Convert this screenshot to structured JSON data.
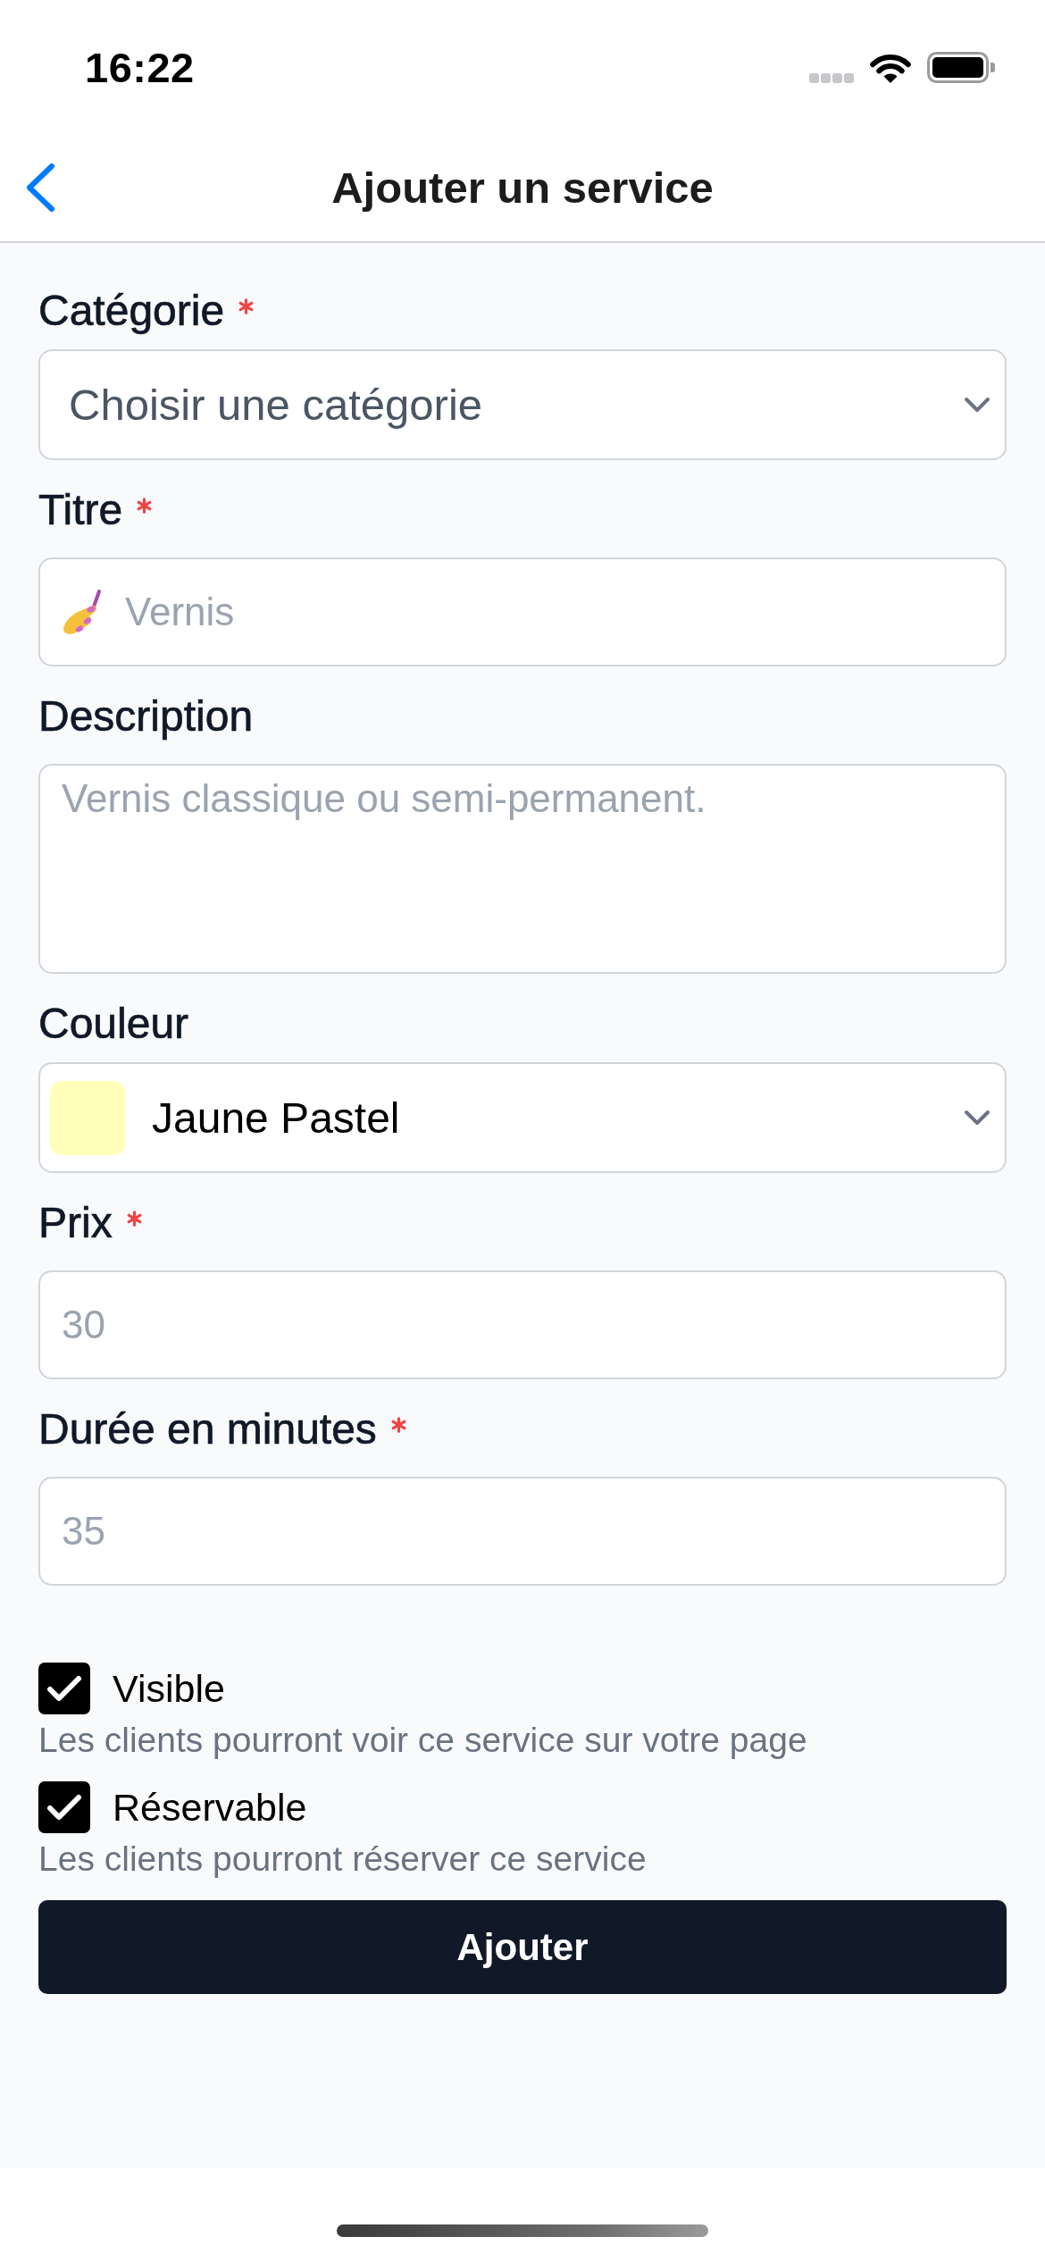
{
  "status_bar": {
    "time": "16:22"
  },
  "nav_bar": {
    "title": "Ajouter un service"
  },
  "form": {
    "fields": [
      {
        "kind": "select",
        "label": "Catégorie",
        "required": true,
        "placeholder": "Choisir une catégorie"
      },
      {
        "kind": "icon_input",
        "label": "Titre",
        "required": true,
        "placeholder": "Vernis"
      },
      {
        "kind": "textarea",
        "label": "Description",
        "required": false,
        "placeholder": "Vernis classique ou semi-permanent."
      },
      {
        "kind": "select",
        "label": "Couleur",
        "required": false,
        "value": "Jaune Pastel",
        "color": "#ffffba"
      },
      {
        "kind": "input",
        "label": "Prix",
        "required": true,
        "placeholder": "30"
      },
      {
        "kind": "input",
        "label": "Durée en minutes",
        "required": true,
        "placeholder": "35"
      }
    ],
    "options": [
      {
        "label": "Visible",
        "checked": true,
        "hint": "Les clients pourront voir ce service sur votre page"
      },
      {
        "label": "Réservable",
        "checked": true,
        "hint": "Les clients pourront réserver ce service"
      }
    ],
    "submit_button": {
      "label": "Ajouter"
    }
  }
}
